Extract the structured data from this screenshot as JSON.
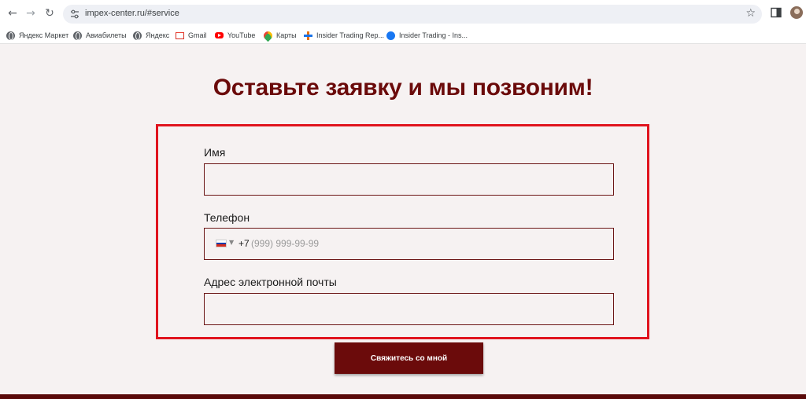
{
  "browser": {
    "url": "impex-center.ru/#service",
    "nav": {
      "back_icon": "arrow-left-icon",
      "forward_icon": "arrow-right-icon",
      "reload_icon": "reload-icon"
    },
    "bookmarks": [
      {
        "label": "Яндекс Маркет",
        "icon": "globe-icon"
      },
      {
        "label": "Авиабилеты",
        "icon": "globe-icon"
      },
      {
        "label": "Яндекс",
        "icon": "globe-icon"
      },
      {
        "label": "Gmail",
        "icon": "gmail-icon"
      },
      {
        "label": "YouTube",
        "icon": "youtube-icon"
      },
      {
        "label": "Карты",
        "icon": "maps-icon"
      },
      {
        "label": "Insider Trading Rep...",
        "icon": "insider-trading-icon"
      },
      {
        "label": "Insider Trading - Ins...",
        "icon": "facebook-icon"
      }
    ]
  },
  "form": {
    "title": "Оставьте заявку и мы позвоним!",
    "name_label": "Имя",
    "name_value": "",
    "phone_label": "Телефон",
    "phone_country": "RU",
    "phone_code": "+7",
    "phone_placeholder": "(999) 999-99-99",
    "email_label": "Адрес электронной почты",
    "email_value": "",
    "submit_label": "Свяжитесь со мной"
  },
  "colors": {
    "accent": "#6b0b0b",
    "highlight": "#e0141e",
    "background": "#f6f2f2"
  }
}
